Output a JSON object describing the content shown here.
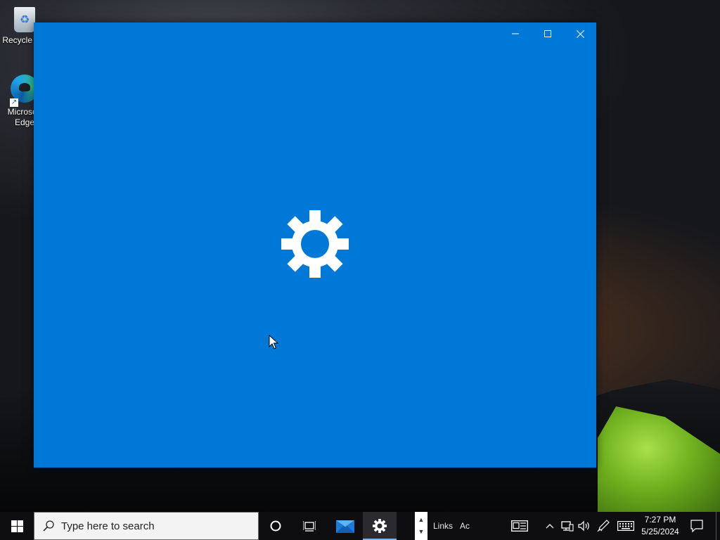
{
  "desktop": {
    "icons": [
      {
        "label": "Recycle Bin",
        "icon": "recycle-bin-icon"
      },
      {
        "label": "Microsoft Edge",
        "icon": "edge-icon"
      }
    ]
  },
  "window": {
    "app": "Settings",
    "splash_icon": "gear-icon",
    "background_color": "#0078d7",
    "controls": {
      "minimize": "minimize-icon",
      "maximize": "maximize-icon",
      "close": "close-icon"
    }
  },
  "taskbar": {
    "search_placeholder": "Type here to search",
    "toolbar_links": "Links",
    "toolbar_address": "Ac",
    "clock": {
      "time": "7:27 PM",
      "date": "5/25/2024"
    },
    "pinned": [
      "cortana-icon",
      "task-view-icon",
      "mail-icon",
      "settings-icon"
    ],
    "tray": [
      "chevron-up-icon",
      "network-icon",
      "volume-icon",
      "pen-icon",
      "keyboard-icon",
      "action-center-icon"
    ]
  }
}
